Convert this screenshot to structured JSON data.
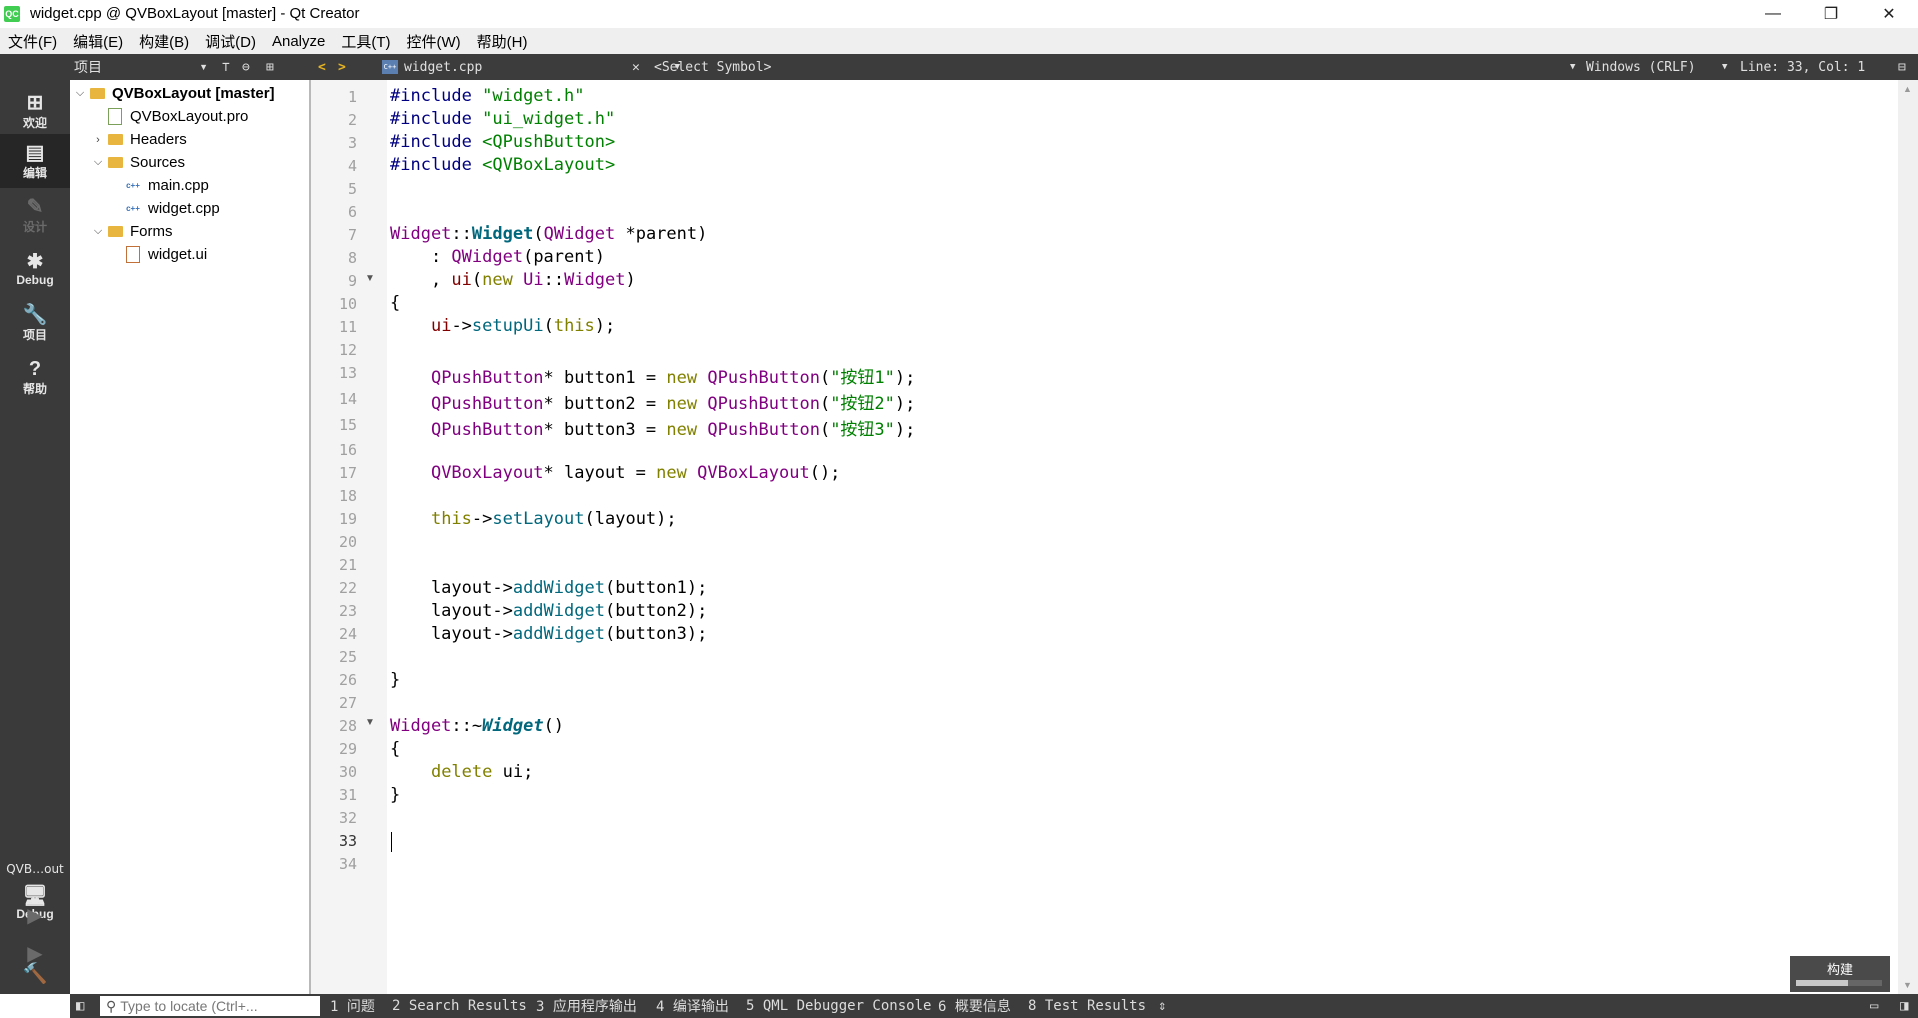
{
  "window": {
    "title": "widget.cpp @ QVBoxLayout [master] - Qt Creator",
    "app_icon_text": "QC",
    "minimize": "—",
    "restore": "❐",
    "close": "✕"
  },
  "menu": [
    "文件(F)",
    "编辑(E)",
    "构建(B)",
    "调试(D)",
    "Analyze",
    "工具(T)",
    "控件(W)",
    "帮助(H)"
  ],
  "modes": [
    {
      "label": "欢迎",
      "icon": "⊞"
    },
    {
      "label": "编辑",
      "icon": "▤"
    },
    {
      "label": "设计",
      "icon": "✎"
    },
    {
      "label": "Debug",
      "icon": "✱"
    },
    {
      "label": "项目",
      "icon": "🔧"
    },
    {
      "label": "帮助",
      "icon": "?"
    }
  ],
  "kit": {
    "name": "QVB…out",
    "mode": "Debug",
    "icon": "🖥"
  },
  "run_buttons": {
    "run": "▶",
    "debug_run": "▶",
    "build": "🔨"
  },
  "toolbar": {
    "sidebar_selector": "项目",
    "file_name": "widget.cpp",
    "symbol": "<Select Symbol>",
    "encoding": "Windows (CRLF)",
    "position": "Line: 33, Col: 1",
    "filter_icon": "⊤",
    "link_icon": "⊖",
    "split_icon": "⊞",
    "back": "<",
    "forward": ">",
    "close_doc": "✕"
  },
  "project_tree": {
    "root": "QVBoxLayout [master]",
    "pro_file": "QVBoxLayout.pro",
    "headers": "Headers",
    "sources": "Sources",
    "main_cpp": "main.cpp",
    "widget_cpp": "widget.cpp",
    "forms": "Forms",
    "widget_ui": "widget.ui"
  },
  "editor": {
    "current_line": "33",
    "lines": [
      "1",
      "2",
      "3",
      "4",
      "5",
      "6",
      "7",
      "8",
      "9",
      "10",
      "11",
      "12",
      "13",
      "14",
      "15",
      "16",
      "17",
      "18",
      "19",
      "20",
      "21",
      "22",
      "23",
      "24",
      "25",
      "26",
      "27",
      "28",
      "29",
      "30",
      "31",
      "32",
      "33",
      "34"
    ],
    "code": {
      "l1": {
        "kw": "#include",
        "val": " \"widget.h\""
      },
      "l2": {
        "kw": "#include",
        "val": " \"ui_widget.h\""
      },
      "l3": {
        "kw": "#include",
        "val": " <QPushButton>"
      },
      "l4": {
        "kw": "#include",
        "val": " <QVBoxLayout>"
      },
      "l7": {
        "cls": "Widget",
        "sep": "::",
        "fn": "Widget",
        "open": "(",
        "type": "QWidget",
        "rest": " *parent)"
      },
      "l8": {
        "pre": "    : ",
        "type": "QWidget",
        "rest": "(parent)"
      },
      "l9": {
        "pre": "    , ",
        "mem": "ui",
        "open": "(",
        "kw": "new",
        "sp": " ",
        "ns": "Ui",
        "sep": "::",
        "type": "Widget",
        "close": ")"
      },
      "l10": "{",
      "l11": {
        "pre": "    ",
        "mem": "ui",
        "arrow": "->",
        "fn": "setupUi",
        "open": "(",
        "kw": "this",
        "close": ");"
      },
      "l13": {
        "pre": "    ",
        "type": "QPushButton",
        "mid": "* button1 = ",
        "kw": "new",
        "sp": " ",
        "type2": "QPushButton",
        "open": "(",
        "str": "\"按钮1\"",
        "close": ");"
      },
      "l14": {
        "pre": "    ",
        "type": "QPushButton",
        "mid": "* button2 = ",
        "kw": "new",
        "sp": " ",
        "type2": "QPushButton",
        "open": "(",
        "str": "\"按钮2\"",
        "close": ");"
      },
      "l15": {
        "pre": "    ",
        "type": "QPushButton",
        "mid": "* button3 = ",
        "kw": "new",
        "sp": " ",
        "type2": "QPushButton",
        "open": "(",
        "str": "\"按钮3\"",
        "close": ");"
      },
      "l17": {
        "pre": "    ",
        "type": "QVBoxLayout",
        "mid": "* layout = ",
        "kw": "new",
        "sp": " ",
        "type2": "QVBoxLayout",
        "close": "();"
      },
      "l19": {
        "pre": "    ",
        "kw": "this",
        "arrow": "->",
        "fn": "setLayout",
        "rest": "(layout);"
      },
      "l22": {
        "pre": "    layout->",
        "fn": "addWidget",
        "rest": "(button1);"
      },
      "l23": {
        "pre": "    layout->",
        "fn": "addWidget",
        "rest": "(button2);"
      },
      "l24": {
        "pre": "    layout->",
        "fn": "addWidget",
        "rest": "(button3);"
      },
      "l26": "}",
      "l28": {
        "cls": "Widget",
        "sep": "::~",
        "fn": "Widget",
        "rest": "()"
      },
      "l29": "{",
      "l30": {
        "pre": "    ",
        "kw": "delete",
        "rest": " ui;"
      },
      "l31": "}"
    }
  },
  "build_widget": {
    "label": "构建",
    "progress": 0.6
  },
  "bottom": {
    "toggle": "◧",
    "locate_placeholder": "Type to locate (Ctrl+...",
    "locate_icon": "⚲",
    "tabs": [
      "1 问题",
      "2 Search Results",
      "3 应用程序输出",
      "4 编译输出",
      "5 QML Debugger Console",
      "6 概要信息",
      "8 Test Results"
    ],
    "more": "⇕"
  }
}
